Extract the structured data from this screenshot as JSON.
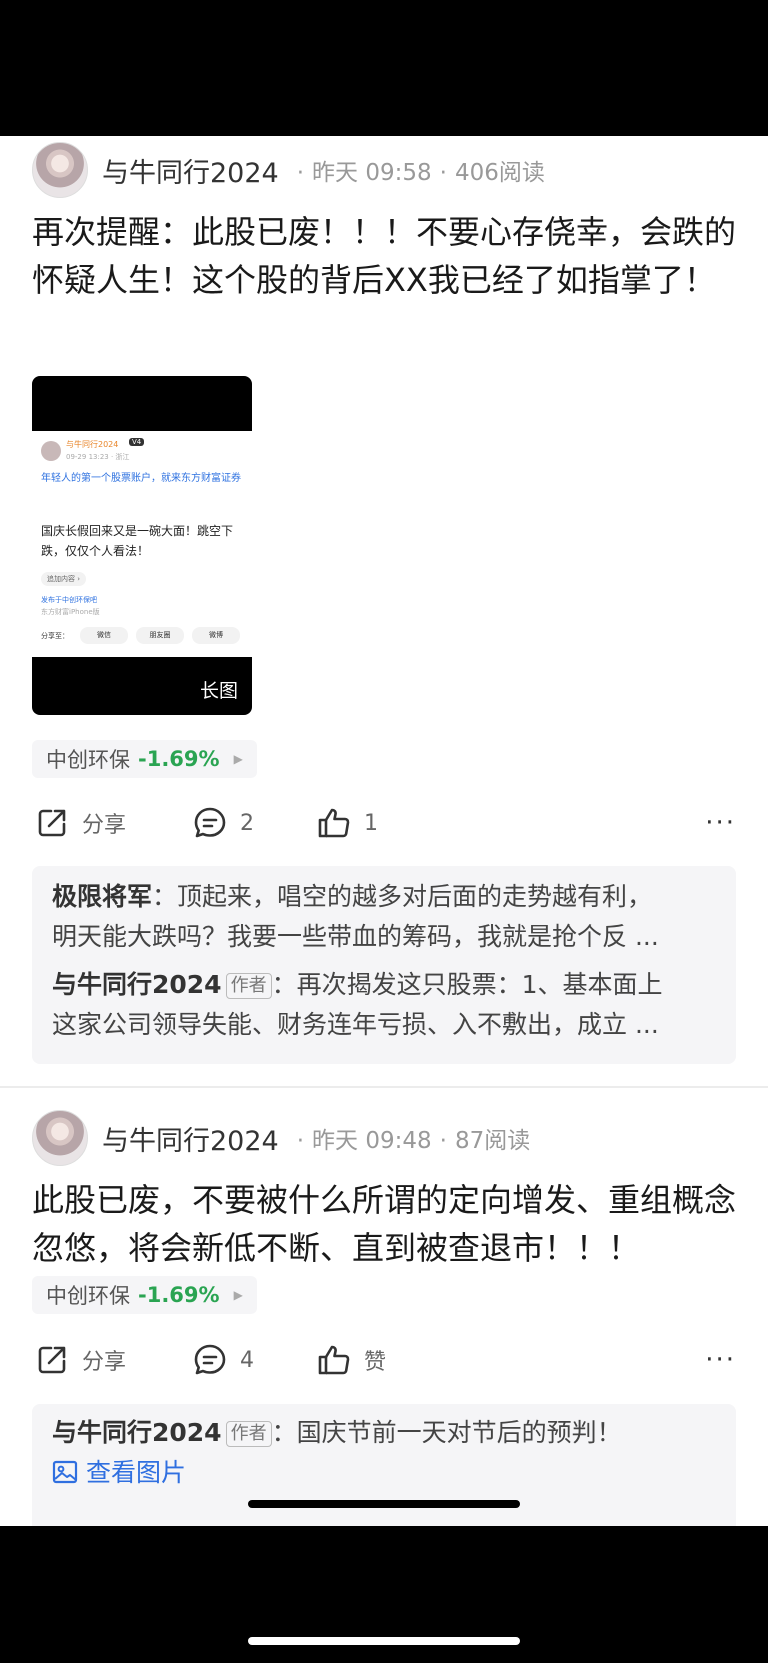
{
  "posts": [
    {
      "username": "与牛同行2024",
      "time": "昨天 09:58",
      "reads": "406阅读",
      "text": "再次提醒：此股已废！！！不要心存侥幸，会跌的怀疑人生！这个股的背后XX我已经了如指掌了！",
      "long_image": {
        "label": "长图",
        "inner_username": "与牛同行2024",
        "inner_badge": "V4",
        "inner_time": "09-29 13:23 · 浙江",
        "inner_ad": "年轻人的第一个股票账户，就来东方财富证券",
        "inner_text": "国庆长假回来又是一碗大面！跳空下跌，仅仅个人看法！",
        "inner_add": "追加内容 ›",
        "inner_from_prefix": "发布于",
        "inner_from_forum": "中创环保吧",
        "inner_from2": "东方财富iPhone版",
        "inner_share": "分享至：",
        "inner_chips": [
          "微信",
          "朋友圈",
          "微博"
        ]
      },
      "stock": {
        "name": "中创环保",
        "change": "-1.69%",
        "arrow": "▶"
      },
      "actions": {
        "share": "分享",
        "comments": "2",
        "likes": "1",
        "more": "···"
      },
      "comments": [
        {
          "name": "极限将军",
          "sep": "：",
          "text": "顶起来，唱空的越多对后面的走势越有利，",
          "text2": "明天能大跌吗？我要一些带血的筹码，我就是抢个反 ..."
        },
        {
          "name": "与牛同行2024",
          "tag": "作者",
          "sep": "：",
          "text": "再次揭发这只股票：1、基本面上",
          "text2": "这家公司领导失能、财务连年亏损、入不敷出，成立 ..."
        }
      ]
    },
    {
      "username": "与牛同行2024",
      "time": "昨天 09:48",
      "reads": "87阅读",
      "text": "此股已废，不要被什么所谓的定向增发、重组概念忽悠，将会新低不断、直到被查退市！！！",
      "stock": {
        "name": "中创环保",
        "change": "-1.69%",
        "arrow": "▶"
      },
      "actions": {
        "share": "分享",
        "comments": "4",
        "likes": "赞",
        "more": "···"
      },
      "comments": [
        {
          "name": "与牛同行2024",
          "tag": "作者",
          "sep": "：",
          "text": "国庆节前一天对节后的预判！",
          "link": "查看图片"
        }
      ]
    }
  ]
}
